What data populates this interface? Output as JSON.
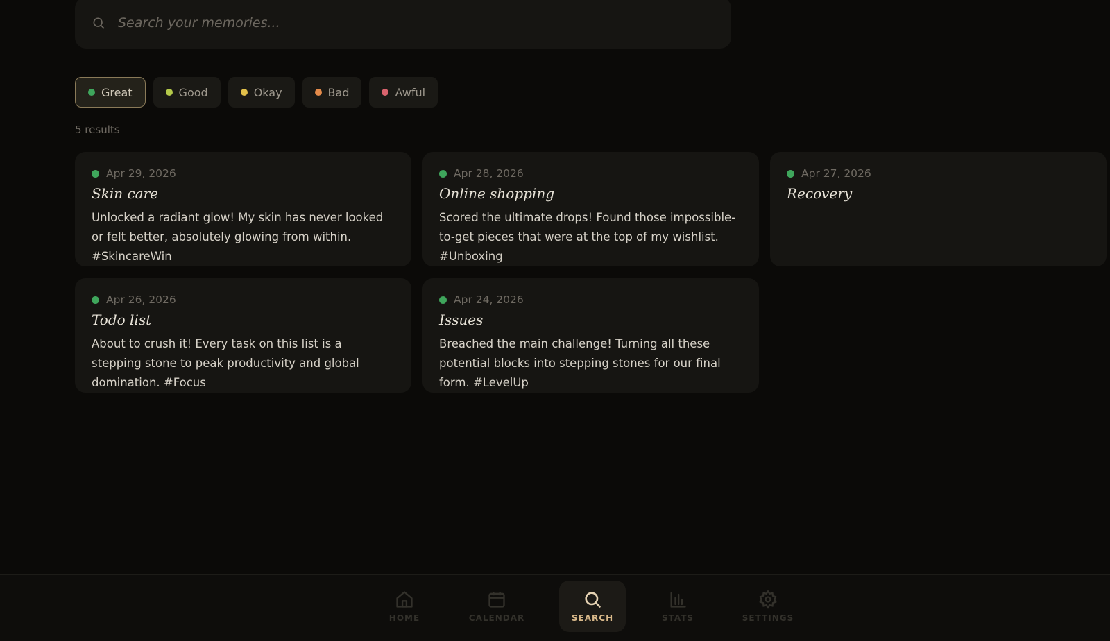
{
  "search": {
    "placeholder": "Search your memories..."
  },
  "filters": [
    {
      "label": "Great",
      "color": "#3fa65c",
      "active": true
    },
    {
      "label": "Good",
      "color": "#b4c94a",
      "active": false
    },
    {
      "label": "Okay",
      "color": "#e2c04a",
      "active": false
    },
    {
      "label": "Bad",
      "color": "#e38a4a",
      "active": false
    },
    {
      "label": "Awful",
      "color": "#d9636d",
      "active": false
    }
  ],
  "results_count": "5 results",
  "entries": [
    {
      "date": "Apr 29, 2026",
      "title": "Skin care",
      "body": "Unlocked a radiant glow! My skin has never looked or felt better, absolutely glowing from within. #SkincareWin"
    },
    {
      "date": "Apr 28, 2026",
      "title": "Online shopping",
      "body": "Scored the ultimate drops! Found those impossible-to-get pieces that were at the top of my wishlist. #Unboxing"
    },
    {
      "date": "Apr 27, 2026",
      "title": "Recovery",
      "body": ""
    },
    {
      "date": "Apr 26, 2026",
      "title": "Todo list",
      "body": "About to crush it! Every task on this list is a stepping stone to peak productivity and global domination. #Focus"
    },
    {
      "date": "Apr 24, 2026",
      "title": "Issues",
      "body": "Breached the main challenge! Turning all these potential blocks into stepping stones for our final form. #LevelUp"
    }
  ],
  "nav": [
    {
      "label": "HOME",
      "icon": "home-icon",
      "active": false
    },
    {
      "label": "CALENDAR",
      "icon": "calendar-icon",
      "active": false
    },
    {
      "label": "SEARCH",
      "icon": "search-icon",
      "active": true
    },
    {
      "label": "STATS",
      "icon": "stats-icon",
      "active": false
    },
    {
      "label": "SETTINGS",
      "icon": "gear-icon",
      "active": false
    }
  ],
  "colors": {
    "accent": "#d9b98a",
    "background": "#0b0a08",
    "card": "#161512"
  }
}
